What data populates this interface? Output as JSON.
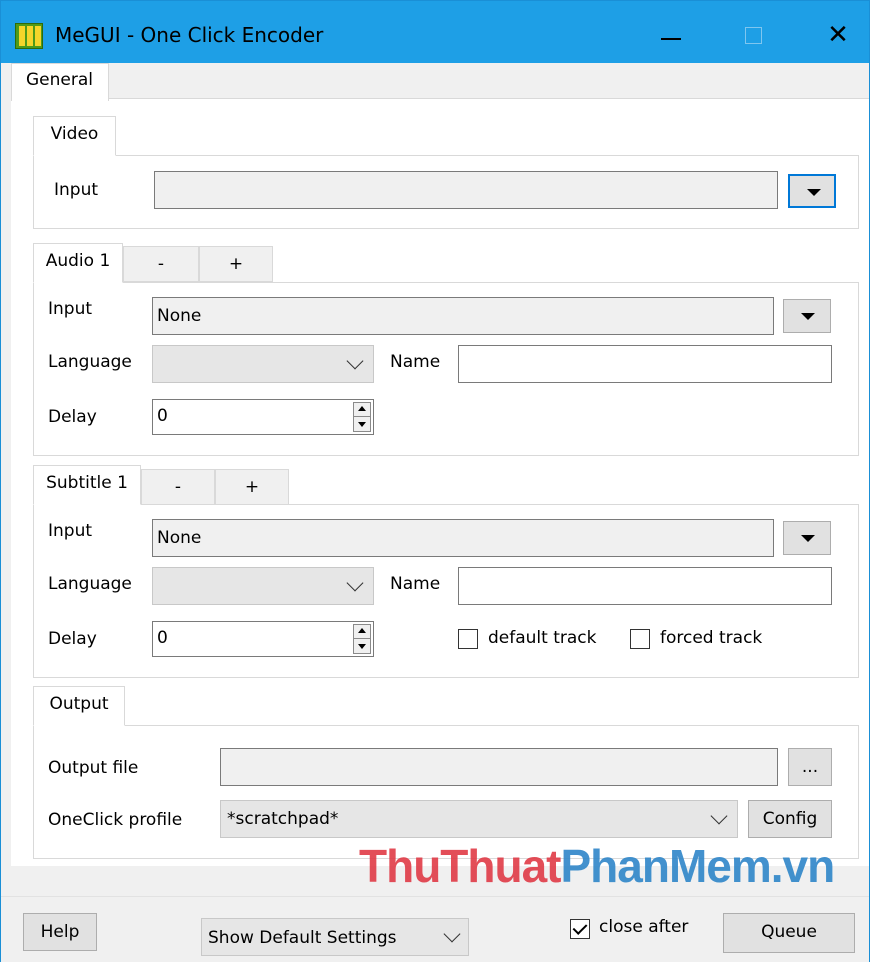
{
  "window": {
    "title": "MeGUI - One Click Encoder",
    "controls": {
      "minimize": "—",
      "maximize": "☐",
      "close": "✕"
    }
  },
  "main_tabs": [
    {
      "label": "General",
      "active": true
    }
  ],
  "video": {
    "tab_label": "Video",
    "input_label": "Input",
    "input_value": ""
  },
  "audio": {
    "tabs": [
      "Audio 1",
      "-",
      "+"
    ],
    "input_label": "Input",
    "input_value": "None",
    "language_label": "Language",
    "language_value": "",
    "name_label": "Name",
    "name_value": "",
    "delay_label": "Delay",
    "delay_value": "0"
  },
  "subtitle": {
    "tabs": [
      "Subtitle 1",
      "-",
      "+"
    ],
    "input_label": "Input",
    "input_value": "None",
    "language_label": "Language",
    "language_value": "",
    "name_label": "Name",
    "name_value": "",
    "delay_label": "Delay",
    "delay_value": "0",
    "default_track_label": "default track",
    "default_track_checked": false,
    "forced_track_label": "forced track",
    "forced_track_checked": false
  },
  "output": {
    "tab_label": "Output",
    "file_label": "Output file",
    "file_value": "",
    "browse_label": "...",
    "profile_label": "OneClick profile",
    "profile_value": "*scratchpad*",
    "config_label": "Config"
  },
  "watermark": {
    "part1": "ThuThuat",
    "part2": "PhanMem.vn"
  },
  "bottom": {
    "help_label": "Help",
    "settings_value": "Show Default Settings",
    "close_after_label": "close after",
    "close_after_checked": true,
    "queue_label": "Queue"
  },
  "colors": {
    "titlebar": "#1e9fe6",
    "focus": "#0078d7",
    "watermark_red": "#e03b47",
    "watermark_blue": "#2f86c9"
  }
}
